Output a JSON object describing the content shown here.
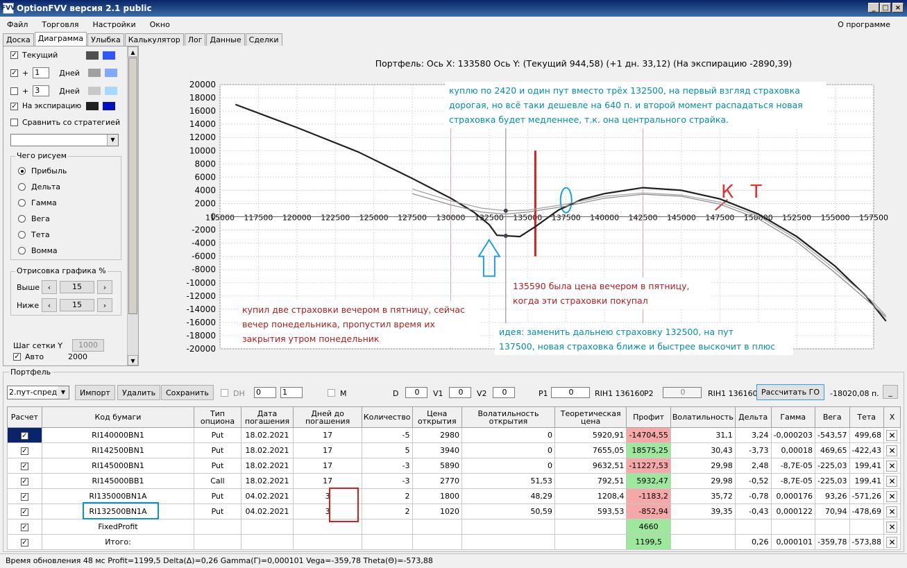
{
  "window": {
    "title": "OptionFVV версия 2.1 public",
    "icon": "app-icon"
  },
  "menu": {
    "items": [
      "Файл",
      "Торговля",
      "Настройки",
      "Окно"
    ],
    "about": "О программе"
  },
  "tabs": [
    "Доска",
    "Диаграмма",
    "Улыбка",
    "Калькулятор",
    "Лог",
    "Данные",
    "Сделки"
  ],
  "left": {
    "current": "Текущий",
    "plus": "+",
    "days": "Дней",
    "days1": "1",
    "days3": "3",
    "expiry": "На экспирацию",
    "compare": "Сравнить со стратегией",
    "what_draw": "Чего рисуем",
    "radios": [
      "Прибыль",
      "Дельта",
      "Гамма",
      "Вега",
      "Тета",
      "Вомма"
    ],
    "draw_pct": "Отрисовка графика %",
    "above": "Выше",
    "below": "Ниже",
    "above_val": "15",
    "below_val": "15",
    "grid_step": "Шаг сетки Y",
    "grid_val": "1000",
    "auto": "Авто",
    "auto_val": "2000",
    "colors": {
      "cur_dark": "#505050",
      "cur_light": "#3355ff",
      "d1_dark": "#a0a0a0",
      "d1_light": "#7fa8ff",
      "d3_dark": "#c8c8c8",
      "d3_light": "#a8d8ff",
      "exp_dark": "#202020",
      "exp_light": "#0010c0"
    }
  },
  "chart_data": {
    "type": "line",
    "title": "Портфель: Ось X: 133580 Ось Y:  (Текущий 944,58)  (+1 дн. 33,12)  (На экспирацию -2890,39)",
    "x_ticks": [
      115000,
      117500,
      120000,
      122500,
      125000,
      127500,
      130000,
      132500,
      135000,
      137500,
      140000,
      142500,
      145000,
      147500,
      150000,
      152500,
      155000,
      157500
    ],
    "y_ticks": [
      20000,
      18000,
      16000,
      14000,
      12000,
      10000,
      8000,
      6000,
      4000,
      2000,
      0,
      -2000,
      -4000,
      -6000,
      -8000,
      -10000,
      -12000,
      -14000,
      -16000,
      -18000,
      -20000
    ],
    "xlim": [
      115000,
      157500
    ],
    "ylim": [
      -20000,
      20000
    ],
    "grid": true,
    "series": [
      {
        "values": [
          [
            116000,
            17000
          ],
          [
            120000,
            13500
          ],
          [
            124000,
            9800
          ],
          [
            127500,
            5800
          ],
          [
            130000,
            2800
          ],
          [
            131500,
            700
          ],
          [
            132500,
            -1200
          ],
          [
            133000,
            -2800
          ],
          [
            134500,
            -3000
          ],
          [
            135500,
            -1500
          ],
          [
            137000,
            1000
          ],
          [
            138500,
            2600
          ],
          [
            140000,
            3500
          ],
          [
            142500,
            4400
          ],
          [
            145000,
            4000
          ],
          [
            147500,
            2700
          ],
          [
            150000,
            400
          ],
          [
            152500,
            -3000
          ],
          [
            155000,
            -7500
          ],
          [
            157000,
            -12000
          ],
          [
            158300,
            -15800
          ]
        ]
      },
      {
        "values": [
          [
            127500,
            4200
          ],
          [
            130000,
            2400
          ],
          [
            132000,
            1300
          ],
          [
            133580,
            900
          ],
          [
            135000,
            1000
          ],
          [
            137500,
            1900
          ],
          [
            140000,
            3100
          ],
          [
            142500,
            3600
          ],
          [
            145000,
            3300
          ],
          [
            147500,
            2200
          ],
          [
            150000,
            100
          ],
          [
            152500,
            -3400
          ],
          [
            155000,
            -8000
          ],
          [
            157500,
            -13000
          ],
          [
            158300,
            -15000
          ]
        ]
      },
      {
        "values": [
          [
            127500,
            3500
          ],
          [
            130000,
            1800
          ],
          [
            132000,
            700
          ],
          [
            133580,
            400
          ],
          [
            135000,
            700
          ],
          [
            137500,
            1600
          ],
          [
            140000,
            2800
          ],
          [
            142500,
            3400
          ],
          [
            145000,
            3100
          ],
          [
            147500,
            1900
          ],
          [
            150000,
            -300
          ],
          [
            152500,
            -3800
          ],
          [
            155000,
            -8500
          ],
          [
            157500,
            -13500
          ],
          [
            158300,
            -15200
          ]
        ]
      }
    ],
    "vlines": {
      "grey": 133580,
      "pink": [
        130000,
        142500
      ],
      "red_marker": 135500
    },
    "points": [
      [
        133580,
        900
      ],
      [
        133580,
        -2890
      ]
    ],
    "annotations": [
      "купил две страховки вечером в пятницу, сейчас\nвечер понедельника, пропустил время их\nзакрытия утром понедельник",
      "куплю по 2420 и один пут вместо трёх 132500, на первый взгляд страховка\nдорогая, но всё таки дешевле на 640 п. и второй момент распадаться новая\nстраховка будет медленнее, т.к. она центрального страйка.",
      "135590 была цена вечером в пятницу,\nкогда эти страховки покупал",
      "идея: заменить дальнею страховку 132500, на пут\n137500, новая страховка ближе и быстрее выскочит в плюс",
      "К Т"
    ]
  },
  "portfolio": {
    "label": "Портфель",
    "strategy": "2.пут-спред",
    "import": "Импорт",
    "delete": "Удалить",
    "save": "Сохранить",
    "dh": "DH",
    "dh_a": "0",
    "dh_b": "1",
    "m": "M",
    "d": "D",
    "d_val": "0",
    "v1": "V1",
    "v1_val": "0",
    "v2": "V2",
    "v2_val": "0",
    "p1": "P1",
    "p1_val": "0",
    "rih1": "RIH1 136160",
    "p2": "P2",
    "p2_val": "0",
    "rih2": "RIH1 136160",
    "calc_go": "Рассчитать ГО",
    "go_val": "-18020,08 п.",
    "min": "_"
  },
  "table": {
    "headers": [
      "Расчет",
      "Код бумаги",
      "Тип опциона",
      "Дата погашения",
      "Дней до погашения",
      "Количество",
      "Цена открытия",
      "Волатильность открытия",
      "Теоретическая цена",
      "Профит",
      "Волатильность",
      "Дельта",
      "Гамма",
      "Вега",
      "Тета",
      "X"
    ],
    "rows": [
      [
        "RI140000BN1",
        "Put",
        "18.02.2021",
        "17",
        "-5",
        "2980",
        "0",
        "5920,91",
        "-14704,55",
        "31,1",
        "3,24",
        "-0,000203",
        "-543,57",
        "499,68"
      ],
      [
        "RI142500BN1",
        "Put",
        "18.02.2021",
        "17",
        "5",
        "3940",
        "0",
        "7655,05",
        "18575,25",
        "30,43",
        "-3,73",
        "0,00018",
        "469,65",
        "-422,43"
      ],
      [
        "RI145000BN1",
        "Put",
        "18.02.2021",
        "17",
        "-3",
        "5890",
        "0",
        "9632,51",
        "-11227,53",
        "29,98",
        "2,48",
        "-8,7E-05",
        "-225,03",
        "199,41"
      ],
      [
        "RI145000BB1",
        "Call",
        "18.02.2021",
        "17",
        "-3",
        "2770",
        "51,53",
        "792,51",
        "5932,47",
        "29,98",
        "-0,52",
        "-8,7E-05",
        "-225,03",
        "199,41"
      ],
      [
        "RI135000BN1A",
        "Put",
        "04.02.2021",
        "3",
        "2",
        "1800",
        "48,29",
        "1208,4",
        "-1183,2",
        "35,72",
        "-0,78",
        "0,000176",
        "93,26",
        "-571,26"
      ],
      [
        "RI132500BN1A",
        "Put",
        "04.02.2021",
        "3",
        "2",
        "1020",
        "50,59",
        "593,53",
        "-852,94",
        "39,35",
        "-0,43",
        "0,000122",
        "70,94",
        "-478,69"
      ]
    ],
    "fixed": {
      "label": "FixedProfit",
      "profit": "4660"
    },
    "total": {
      "label": "Итого:",
      "profit": "1199,5",
      "delta": "0,26",
      "gamma": "0,000101",
      "vega": "-359,78",
      "theta": "-573,88"
    }
  },
  "status": "Время обновления 48 мс  Profit=1199,5 Delta(Δ)=0,26 Gamma(Γ)=0,000101 Vega=-359,78 Theta(Θ)=-573,88"
}
